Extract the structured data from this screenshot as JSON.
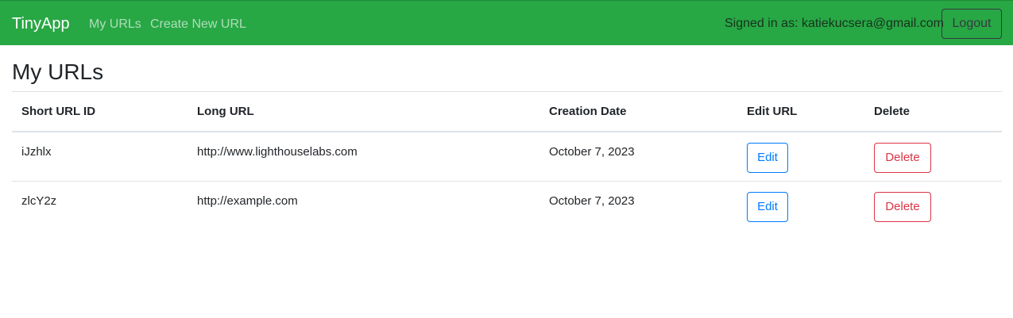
{
  "navbar": {
    "brand": "TinyApp",
    "links": [
      "My URLs",
      "Create New URL"
    ],
    "signed_in_text": "Signed in as: katiekucsera@gmail.com",
    "logout_label": "Logout",
    "background_color": "#28a745"
  },
  "page": {
    "title": "My URLs"
  },
  "table": {
    "headers": [
      "Short URL ID",
      "Long URL",
      "Creation Date",
      "Edit URL",
      "Delete"
    ],
    "rows": [
      {
        "short_id": "iJzhlx",
        "long_url": "http://www.lighthouselabs.com",
        "created": "October 7, 2023",
        "edit_label": "Edit",
        "delete_label": "Delete"
      },
      {
        "short_id": "zlcY2z",
        "long_url": "http://example.com",
        "created": "October 7, 2023",
        "edit_label": "Edit",
        "delete_label": "Delete"
      }
    ]
  },
  "colors": {
    "edit_button": "#007bff",
    "delete_button": "#dc3545"
  }
}
